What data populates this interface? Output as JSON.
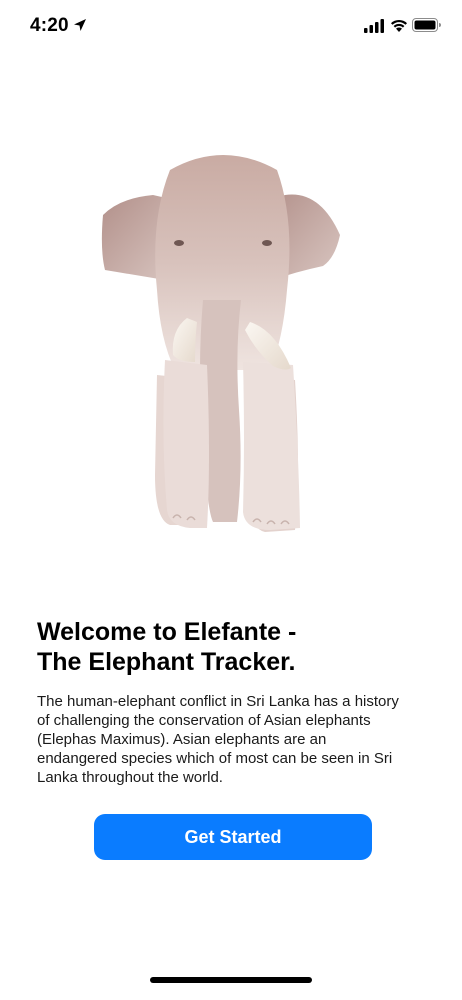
{
  "status_bar": {
    "time": "4:20",
    "icons": [
      "location-arrow-icon",
      "cellular-signal-icon",
      "wifi-icon",
      "battery-icon"
    ]
  },
  "hero": {
    "image": "elephant-illustration"
  },
  "content": {
    "title": "Welcome to Elefante -\nThe Elephant Tracker.",
    "description": "The human-elephant conflict in Sri Lanka has a history of challenging the conservation of Asian elephants (Elephas Maximus). Asian elephants are an endangered species which of most can be seen in Sri Lanka throughout the world."
  },
  "actions": {
    "get_started_label": "Get Started"
  },
  "colors": {
    "accent": "#0a7cff",
    "background": "#ffffff",
    "text": "#000000"
  }
}
